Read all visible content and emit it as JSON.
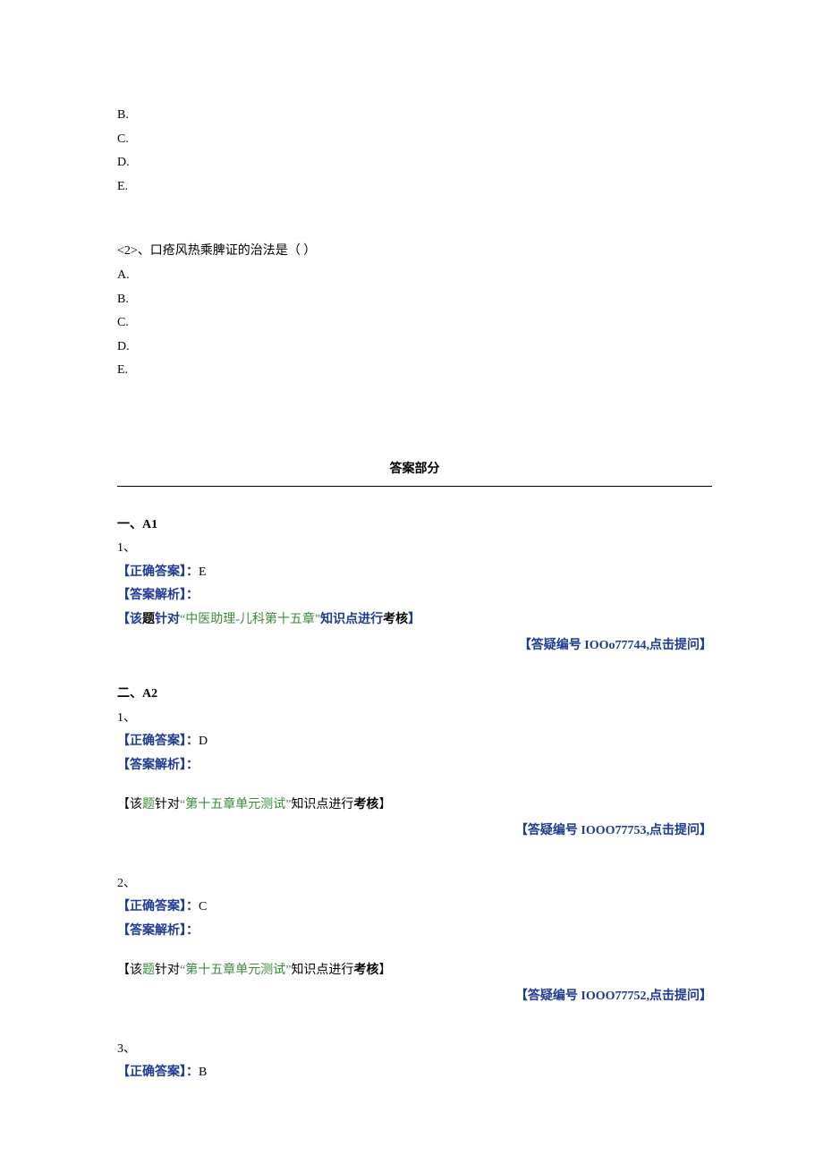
{
  "q1": {
    "opts": [
      "B.",
      "C.",
      "D.",
      "E."
    ]
  },
  "q2": {
    "prompt": "<2>、口疮风热乘脾证的治法是（ ）",
    "opts": [
      "A.",
      "B.",
      "C.",
      "D.",
      "E."
    ]
  },
  "answers_header": "答案部分",
  "labels": {
    "correct": "【正确答案】：",
    "analysis": "【答案解析】：",
    "topic_prefix": "【该",
    "topic_mid1": "题",
    "topic_mid2": "针对",
    "quote_open": "“",
    "quote_close": "”",
    "knowledge_tail": "知识点进行",
    "exam": "考核",
    "bracket_close": "】",
    "ask_prefix": "【答疑编号 ",
    "ask_suffix": ",点击提问】"
  },
  "sections": [
    {
      "title": "一、A1",
      "items": [
        {
          "num": "1、",
          "answer": "E",
          "topic": "中医助理-儿科第十五章",
          "ask_code": "IOOo77744"
        }
      ]
    },
    {
      "title": "二、A2",
      "items": [
        {
          "num": "1、",
          "answer": "D",
          "topic": "第十五章单元测试",
          "ask_code": "IOOO77753"
        },
        {
          "num": "2、",
          "answer": "C",
          "topic": "第十五章单元测试",
          "ask_code": "IOOO77752"
        },
        {
          "num": "3、",
          "answer": "B",
          "topic": "",
          "ask_code": ""
        }
      ]
    }
  ]
}
